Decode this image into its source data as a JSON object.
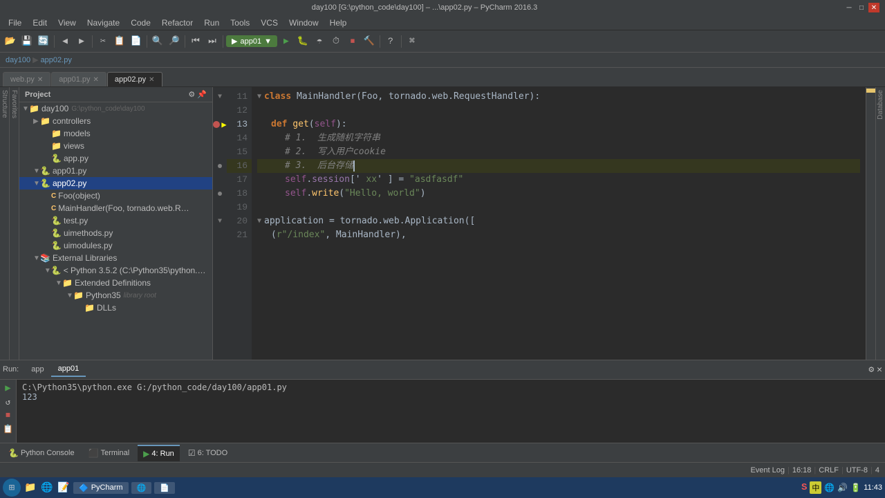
{
  "titleBar": {
    "text": "day100 [G:\\python_code\\day100] – ...\\app02.py – PyCharm 2016.3",
    "minimize": "─",
    "maximize": "□",
    "close": "✕"
  },
  "menuBar": {
    "items": [
      "File",
      "Edit",
      "View",
      "Navigate",
      "Code",
      "Refactor",
      "Run",
      "Tools",
      "VCS",
      "Window",
      "Help"
    ]
  },
  "toolbar": {
    "runConfig": "app01",
    "runLabel": "▶"
  },
  "tabs": [
    {
      "label": "web.py",
      "active": false,
      "hasClose": true
    },
    {
      "label": "app01.py",
      "active": false,
      "hasClose": true
    },
    {
      "label": "app02.py",
      "active": true,
      "hasClose": true
    }
  ],
  "projectPanel": {
    "header": "Project",
    "tree": [
      {
        "indent": 0,
        "arrow": "▼",
        "icon": "📁",
        "label": "day100",
        "sub": "G:\\python_code\\day100",
        "selected": false
      },
      {
        "indent": 1,
        "arrow": "▼",
        "icon": "📁",
        "label": "controllers",
        "selected": false
      },
      {
        "indent": 2,
        "arrow": "",
        "icon": "📁",
        "label": "models",
        "selected": false
      },
      {
        "indent": 2,
        "arrow": "",
        "icon": "📁",
        "label": "views",
        "selected": false
      },
      {
        "indent": 2,
        "arrow": "",
        "icon": "🐍",
        "label": "app.py",
        "selected": false
      },
      {
        "indent": 1,
        "arrow": "▼",
        "icon": "🐍",
        "label": "app01.py",
        "selected": false
      },
      {
        "indent": 2,
        "arrow": "▼",
        "icon": "🐍",
        "label": "app02.py",
        "selected": true
      },
      {
        "indent": 3,
        "arrow": "",
        "icon": "C",
        "label": "Foo(object)",
        "selected": false
      },
      {
        "indent": 3,
        "arrow": "",
        "icon": "C",
        "label": "MainHandler(Foo, tornado.web.R…",
        "selected": false
      },
      {
        "indent": 2,
        "arrow": "",
        "icon": "🐍",
        "label": "test.py",
        "selected": false
      },
      {
        "indent": 2,
        "arrow": "",
        "icon": "🐍",
        "label": "uimethods.py",
        "selected": false
      },
      {
        "indent": 2,
        "arrow": "",
        "icon": "🐍",
        "label": "uimodules.py",
        "selected": false
      },
      {
        "indent": 1,
        "arrow": "▼",
        "icon": "📁",
        "label": "External Libraries",
        "selected": false
      },
      {
        "indent": 2,
        "arrow": "▼",
        "icon": "🐍",
        "label": "< Python 3.5.2 (C:\\Python35\\python.e…",
        "selected": false
      },
      {
        "indent": 3,
        "arrow": "▼",
        "icon": "📁",
        "label": "Extended Definitions",
        "selected": false
      },
      {
        "indent": 4,
        "arrow": "▼",
        "icon": "📁",
        "label": "Python35  library root",
        "selected": false
      },
      {
        "indent": 5,
        "arrow": "",
        "icon": "📁",
        "label": "DLLs",
        "selected": false
      }
    ]
  },
  "codeLines": [
    {
      "num": 11,
      "tokens": [
        {
          "t": "class ",
          "c": "kw"
        },
        {
          "t": "MainHandler",
          "c": "cn"
        },
        {
          "t": "(Foo, tornado.web.RequestHandler):",
          "c": "cls"
        }
      ],
      "gutter": "fold",
      "highlighted": false
    },
    {
      "num": 12,
      "tokens": [],
      "gutter": "",
      "highlighted": false
    },
    {
      "num": 13,
      "tokens": [
        {
          "t": "    ",
          "c": ""
        },
        {
          "t": "def ",
          "c": "kw"
        },
        {
          "t": "get",
          "c": "func"
        },
        {
          "t": "(",
          "c": "paren"
        },
        {
          "t": "self",
          "c": "self-kw"
        },
        {
          "t": "):",
          "c": "paren"
        }
      ],
      "gutter": "bp+arrow",
      "highlighted": false
    },
    {
      "num": 14,
      "tokens": [
        {
          "t": "        ",
          "c": ""
        },
        {
          "t": "# 1.  生成随机字符串",
          "c": "comment"
        }
      ],
      "gutter": "",
      "highlighted": false
    },
    {
      "num": 15,
      "tokens": [
        {
          "t": "        ",
          "c": ""
        },
        {
          "t": "# 2.  写入用户cookie",
          "c": "comment"
        }
      ],
      "gutter": "",
      "highlighted": false
    },
    {
      "num": 16,
      "tokens": [
        {
          "t": "        ",
          "c": ""
        },
        {
          "t": "# 3.  后台存储",
          "c": "comment"
        }
      ],
      "gutter": "dot",
      "highlighted": true
    },
    {
      "num": 17,
      "tokens": [
        {
          "t": "        ",
          "c": ""
        },
        {
          "t": "self",
          "c": "self-kw"
        },
        {
          "t": ".",
          "c": ""
        },
        {
          "t": "session",
          "c": "attr"
        },
        {
          "t": "['",
          "c": ""
        },
        {
          "t": " xx",
          "c": "str"
        },
        {
          "t": "' ] = ",
          "c": ""
        },
        {
          "t": "\"asdfasdf\"",
          "c": "str"
        }
      ],
      "gutter": "",
      "highlighted": false
    },
    {
      "num": 18,
      "tokens": [
        {
          "t": "        ",
          "c": ""
        },
        {
          "t": "self",
          "c": "self-kw"
        },
        {
          "t": ".",
          "c": ""
        },
        {
          "t": "write",
          "c": "func"
        },
        {
          "t": "(",
          "c": "paren"
        },
        {
          "t": "\"Hello, world\"",
          "c": "str"
        },
        {
          "t": ")",
          "c": "paren"
        }
      ],
      "gutter": "dot",
      "highlighted": false
    },
    {
      "num": 19,
      "tokens": [],
      "gutter": "",
      "highlighted": false
    },
    {
      "num": 20,
      "tokens": [
        {
          "t": "application = ",
          "c": ""
        },
        {
          "t": "tornado.web.Application",
          "c": "cn"
        },
        {
          "t": "([",
          "c": ""
        }
      ],
      "gutter": "fold",
      "highlighted": false
    },
    {
      "num": 21,
      "tokens": [
        {
          "t": "    ",
          "c": ""
        },
        {
          "t": "(r\"/index\"",
          "c": "str"
        },
        {
          "t": ", MainHandler),",
          "c": ""
        }
      ],
      "gutter": "",
      "highlighted": false
    }
  ],
  "runPanel": {
    "currentApp": "app",
    "activeTab": "app01",
    "output": "C:\\Python35\\python.exe G:/python_code/day100/app01.py\n123",
    "tabs": [
      "app",
      "app01"
    ]
  },
  "bottomTabs": [
    {
      "label": "Python Console",
      "icon": "🐍",
      "active": false
    },
    {
      "label": "Terminal",
      "icon": "⬜",
      "active": false
    },
    {
      "label": "4: Run",
      "icon": "▶",
      "active": true
    },
    {
      "label": "6: TODO",
      "icon": "☑",
      "active": false
    }
  ],
  "statusBar": {
    "line": "16:18",
    "encoding": "CRLF",
    "charset": "UTF-8",
    "indents": "4"
  },
  "taskbar": {
    "time": "11:43",
    "startIcon": "⊞"
  }
}
